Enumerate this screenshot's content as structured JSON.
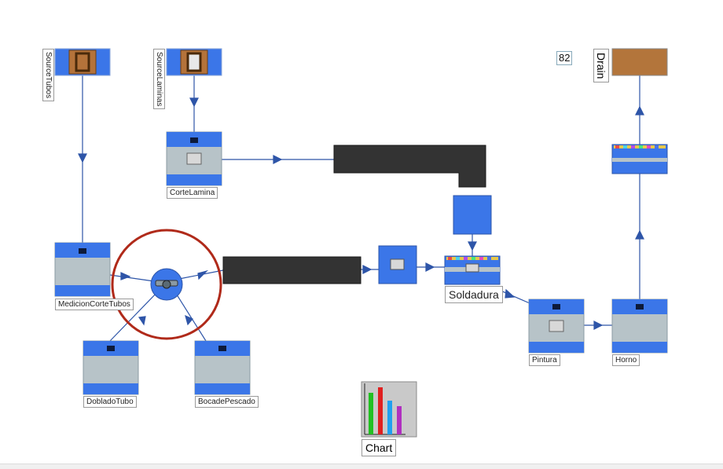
{
  "sources": [
    {
      "id": "src-tubos",
      "label": "SourceTubos"
    },
    {
      "id": "src-laminas",
      "label": "SourceLaminas"
    }
  ],
  "stations": {
    "corte_lamina": "CorteLamina",
    "medicion": "MedicionCorteTubos",
    "doblado": "DobladoTubo",
    "bocade": "BocadePescado",
    "soldadura": "Soldadura",
    "pintura": "Pintura",
    "horno": "Horno"
  },
  "drain": {
    "label": "Drain",
    "count": "82"
  },
  "chart_widget": {
    "label": "Chart"
  },
  "colors": {
    "machine_blue": "#3b76e8",
    "machine_gray": "#b7c3c8",
    "conveyor": "#333333",
    "connector": "#2e55a8",
    "robot_ring": "#b02a1a",
    "source_brown": "#b4733a",
    "drain_brown": "#b3753b"
  },
  "icons": {
    "source": "crate-icon",
    "machine": "machine-icon",
    "robot": "robot-arm-icon",
    "chart": "bar-chart-icon"
  }
}
